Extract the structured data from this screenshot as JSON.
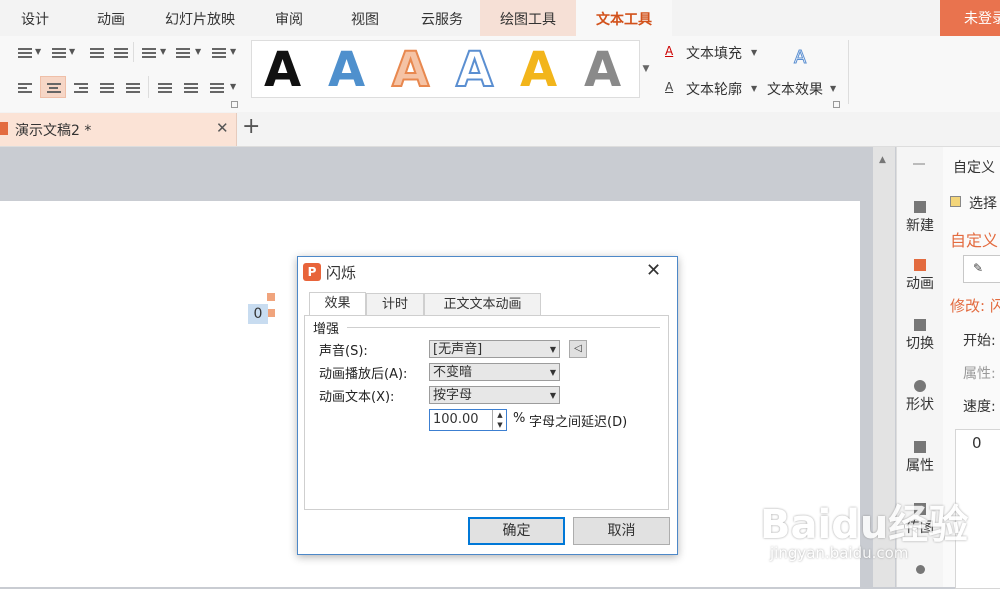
{
  "menu": {
    "tabs": [
      "设计",
      "动画",
      "幻灯片放映",
      "审阅",
      "视图",
      "云服务",
      "绘图工具",
      "文本工具"
    ],
    "login": "未登录"
  },
  "ribbon": {
    "text_fill": "文本填充",
    "text_outline": "文本轮廓",
    "text_effect": "文本效果",
    "style_letter": "A",
    "style_colors": [
      "#111111",
      "#4f90cd",
      "#e8884f",
      "#5b8fd1",
      "#f2b51b",
      "#8a8a8a"
    ]
  },
  "tabs": {
    "doc_name": "演示文稿2 *",
    "new_tab": "+"
  },
  "slide": {
    "anim_marker": "0"
  },
  "sidenav": {
    "items": [
      "新建",
      "动画",
      "切换",
      "形状",
      "属性",
      "传图"
    ]
  },
  "panel": {
    "title": "自定义",
    "select_label": "选择",
    "section_title": "自定义",
    "modify_label": "修改: 闪",
    "start_label": "开始:",
    "property_label": "属性:",
    "speed_label": "速度:",
    "list_value": "0"
  },
  "dialog": {
    "title": "闪烁",
    "tabs": [
      "效果",
      "计时",
      "正文文本动画"
    ],
    "group_title": "增强",
    "sound_label": "声音(S):",
    "sound_value": "[无声音]",
    "after_label": "动画播放后(A):",
    "after_value": "不变暗",
    "text_label": "动画文本(X):",
    "text_value": "按字母",
    "delay_value": "100.00",
    "delay_unit": "%",
    "delay_label": "字母之间延迟(D)",
    "ok": "确定",
    "cancel": "取消"
  },
  "watermark": {
    "brand": "Baidu经验",
    "url": "jingyan.baidu.com"
  }
}
